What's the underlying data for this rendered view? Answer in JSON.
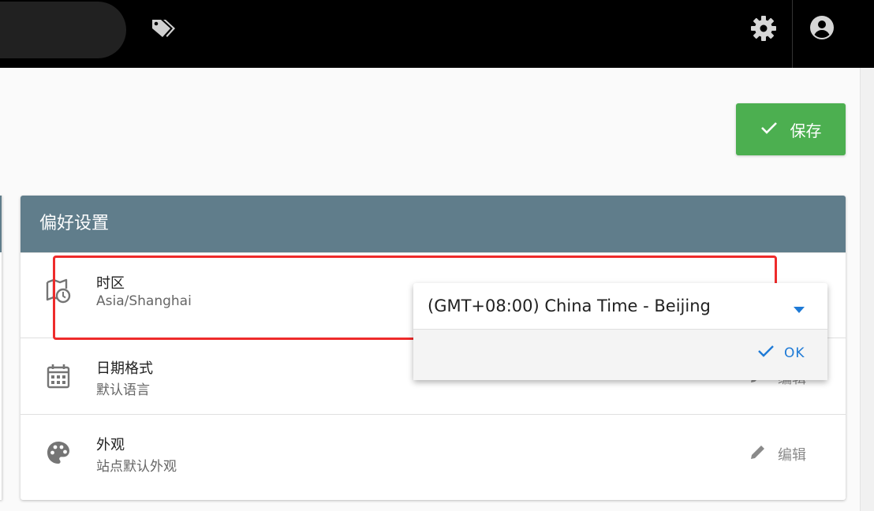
{
  "header": {
    "icons": [
      "tag-icon",
      "gear-icon",
      "account-circle-icon"
    ]
  },
  "toolbar": {
    "save_label": "保存",
    "save_icon": "check-icon"
  },
  "card": {
    "title": "偏好设置",
    "rows": [
      {
        "title": "时区",
        "value": "Asia/Shanghai",
        "icon": "map-clock-icon"
      },
      {
        "title": "日期格式",
        "value": "默认语言",
        "icon": "calendar-icon",
        "edit_label": "编辑"
      },
      {
        "title": "外观",
        "value": "站点默认外观",
        "icon": "palette-icon",
        "edit_label": "编辑"
      }
    ]
  },
  "timezone_dropdown": {
    "selected": "(GMT+08:00) China Time - Beijing",
    "ok_label": "OK"
  },
  "colors": {
    "topbar": "#000000",
    "card_header": "#607d8b",
    "save_button": "#4caf50",
    "highlight": "#ee2b2b",
    "accent": "#1e7ad6"
  }
}
